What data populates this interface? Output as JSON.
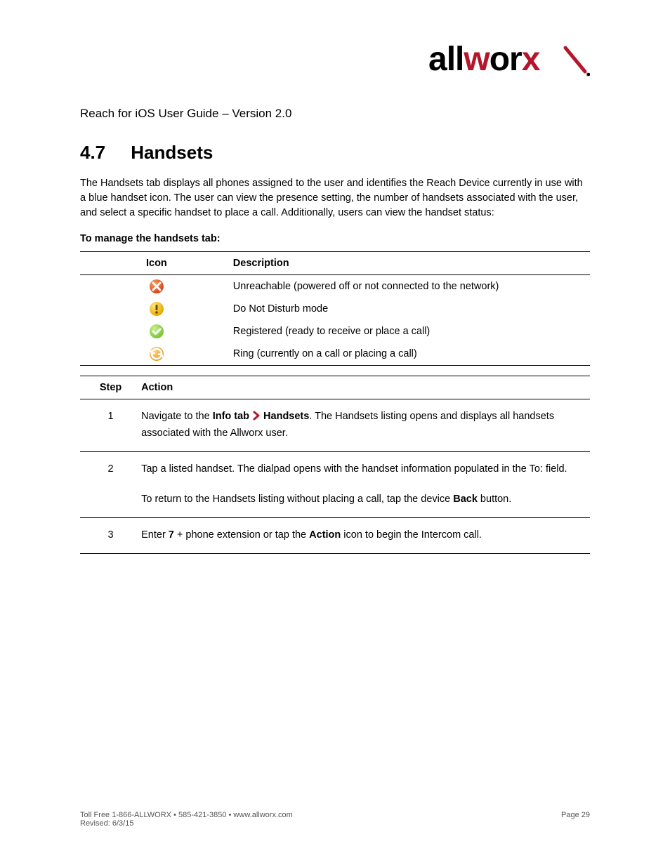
{
  "logo_text": "allworx",
  "doc_title": "Reach for iOS User Guide – Version 2.0",
  "section_number": "4.7",
  "section_title": "Handsets",
  "intro_text": "The Handsets tab displays all phones assigned to the user and identifies the Reach Device currently in use with a blue handset icon. The user can view the presence setting, the number of handsets associated with the user, and select a specific handset to place a call. Additionally, users can view the handset status:",
  "to_manage_label": "To manage the handsets tab:",
  "icon_table": {
    "header_icon": "Icon",
    "header_desc": "Description",
    "rows": [
      {
        "icon": "unreachable",
        "desc": "Unreachable (powered off or not connected to the network)"
      },
      {
        "icon": "dnd",
        "desc": "Do Not Disturb mode"
      },
      {
        "icon": "registered",
        "desc": "Registered (ready to receive or place a call)"
      },
      {
        "icon": "ring",
        "desc": "Ring (currently on a call or placing a call)"
      }
    ]
  },
  "steps": {
    "header_step": "Step",
    "header_action": "Action",
    "rows": [
      {
        "num": "1",
        "parts": [
          {
            "t": "Navigate to the ",
            "b": false
          },
          {
            "t": "Info tab",
            "b": true
          },
          {
            "t": " > ",
            "b": false,
            "chev": true
          },
          {
            "t": "Handsets",
            "b": true
          },
          {
            "t": ". The Handsets listing opens and displays all handsets associated with the Allworx user.",
            "b": false
          }
        ]
      },
      {
        "num": "2",
        "parts": [
          {
            "t": "Tap a listed handset. The dialpad opens with the handset information populated in the To: field.\n\n",
            "b": false
          },
          {
            "t": "To return to the Handsets listing without placing a call, tap the device ",
            "b": false
          },
          {
            "t": "Back",
            "b": true
          },
          {
            "t": " button.",
            "b": false
          }
        ]
      },
      {
        "num": "3",
        "parts": [
          {
            "t": "Enter ",
            "b": false
          },
          {
            "t": "7",
            "b": true
          },
          {
            "t": " + phone extension or tap the ",
            "b": false
          },
          {
            "t": "Action",
            "b": true
          },
          {
            "t": " icon to begin the Intercom call.",
            "b": false
          }
        ]
      }
    ]
  },
  "footer_left": "Toll Free 1-866-ALLWORX • 585-421-3850 • www.allworx.com\nRevised: 6/3/15",
  "footer_right": "Page 29"
}
